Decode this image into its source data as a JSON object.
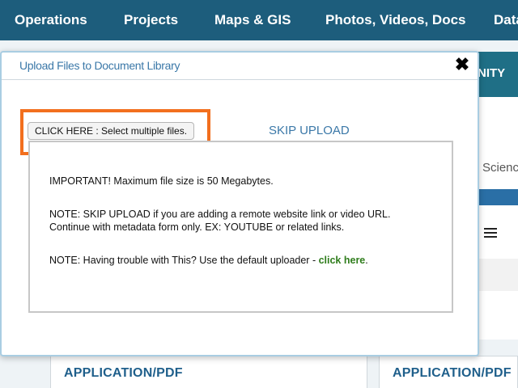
{
  "topnav": {
    "items": [
      "Operations",
      "Projects",
      "Maps & GIS",
      "Photos, Videos, Docs",
      "Data"
    ]
  },
  "background": {
    "band_text": "NITY",
    "side_text": "Scienc",
    "cards": [
      "APPLICATION/PDF",
      "APPLICATION/PDF"
    ]
  },
  "modal": {
    "title": "Upload Files to Document Library",
    "close_glyph": "✖",
    "select_button_label": "CLICK HERE : Select multiple files.",
    "skip_upload_label": "SKIP UPLOAD",
    "info": {
      "important": "IMPORTANT! Maximum file size is 50 Megabytes.",
      "note_skip_line1": "NOTE: SKIP UPLOAD if you are adding a remote website link or video URL.",
      "note_skip_line2": "Continue with metadata form only. EX: YOUTUBE or related links.",
      "note_trouble": "NOTE: Having trouble with This? Use the default uploader - ",
      "trouble_link": "click here",
      "trouble_suffix": "."
    }
  },
  "colors": {
    "nav_bg": "#1d5d7c",
    "highlight": "#f26f1e",
    "link_blue": "#3b78a8",
    "link_green": "#2f7d1c"
  }
}
